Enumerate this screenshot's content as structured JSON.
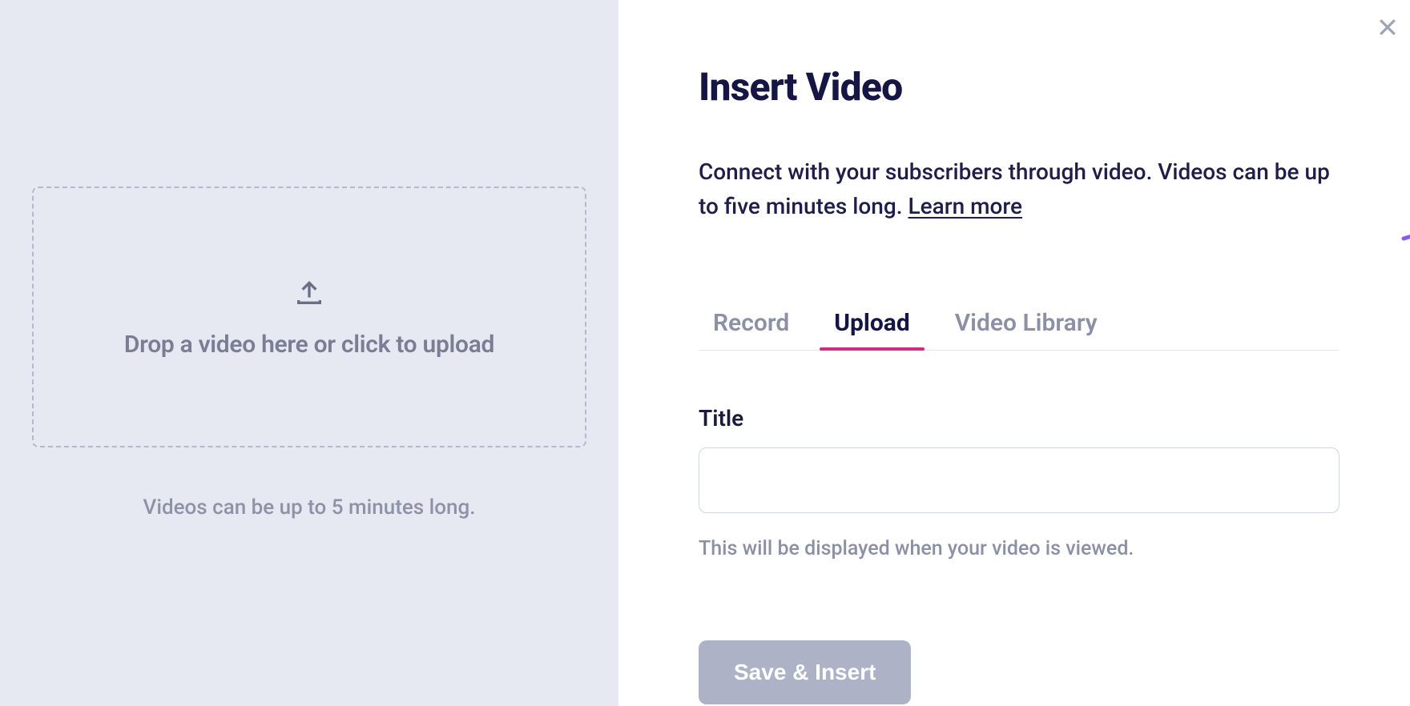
{
  "modal": {
    "heading": "Insert Video",
    "description_prefix": "Connect with your subscribers through video. Videos can be up to five minutes long. ",
    "learn_more": "Learn more",
    "close_label": "Close"
  },
  "dropzone": {
    "prompt": "Drop a video here or click to upload",
    "limit_text": "Videos can be up to 5 minutes long."
  },
  "tabs": {
    "record": "Record",
    "upload": "Upload",
    "library": "Video Library",
    "active": "upload"
  },
  "form": {
    "title_label": "Title",
    "title_value": "",
    "title_help": "This will be displayed when your video is viewed.",
    "save_button": "Save & Insert"
  },
  "colors": {
    "accent_purple": "#8a5cf6",
    "accent_pink": "#d42b7e",
    "ink": "#161645",
    "muted": "#8c90a4",
    "panel_bg": "#e7e9f2",
    "button_disabled": "#aeb2c6"
  }
}
